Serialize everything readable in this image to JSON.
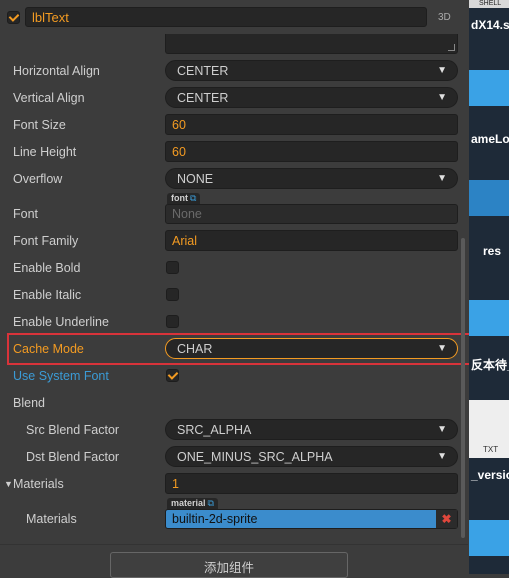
{
  "component": {
    "name": "lblText",
    "badge": "3D",
    "enabled": true
  },
  "rows": {
    "horizontal_align": {
      "label": "Horizontal Align",
      "value": "CENTER"
    },
    "vertical_align": {
      "label": "Vertical Align",
      "value": "CENTER"
    },
    "font_size": {
      "label": "Font Size",
      "value": "60"
    },
    "line_height": {
      "label": "Line Height",
      "value": "60"
    },
    "overflow": {
      "label": "Overflow",
      "value": "NONE"
    },
    "font": {
      "label": "Font",
      "tag": "font",
      "value": "None"
    },
    "font_family": {
      "label": "Font Family",
      "value": "Arial"
    },
    "enable_bold": {
      "label": "Enable Bold",
      "checked": false
    },
    "enable_italic": {
      "label": "Enable Italic",
      "checked": false
    },
    "enable_underline": {
      "label": "Enable Underline",
      "checked": false
    },
    "cache_mode": {
      "label": "Cache Mode",
      "value": "CHAR"
    },
    "use_system_font": {
      "label": "Use System Font",
      "checked": true
    },
    "blend": {
      "label": "Blend"
    },
    "src_blend_factor": {
      "label": "Src Blend Factor",
      "value": "SRC_ALPHA"
    },
    "dst_blend_factor": {
      "label": "Dst Blend Factor",
      "value": "ONE_MINUS_SRC_ALPHA"
    },
    "materials_count": {
      "label": "Materials",
      "value": "1"
    },
    "materials_item": {
      "label": "Materials",
      "tag": "material",
      "value": "builtin-2d-sprite"
    }
  },
  "add_component_label": "添加组件",
  "icons": {
    "dropdown": "triangle-down-icon",
    "link": "external-link-icon",
    "remove": "close-icon",
    "expand": "triangle-down-icon"
  },
  "colors": {
    "accent": "#f39b22",
    "link": "#3b9bd6",
    "highlight": "#d9333a",
    "asset": "#3b8ccc"
  },
  "side_strip": {
    "header": "SHELL",
    "items": [
      "dX14.s",
      "ameLo",
      "res",
      "反本待_",
      "TXT",
      "_versio"
    ]
  }
}
